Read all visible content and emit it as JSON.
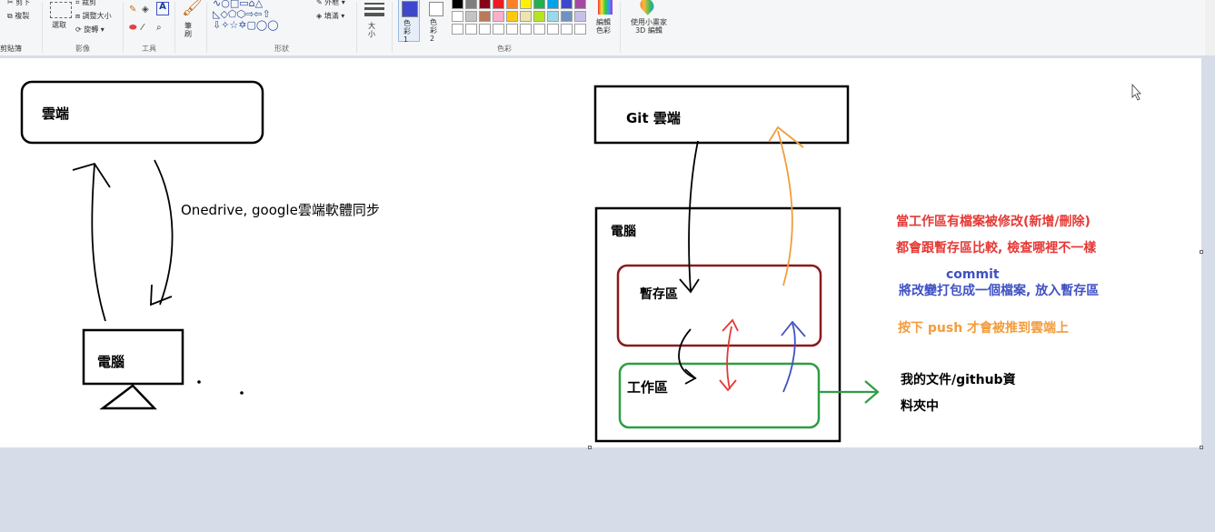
{
  "ribbon": {
    "clipboard": {
      "cut": "剪下",
      "copy": "複製",
      "label": "剪貼簿"
    },
    "image": {
      "select": "選取",
      "crop": "裁剪",
      "resize": "調整大小",
      "rotate": "旋轉",
      "label": "影像"
    },
    "tools": {
      "label": "工具"
    },
    "brushes": {
      "label": "筆刷"
    },
    "shapes": {
      "outline": "外框",
      "fill": "填滿",
      "label": "形狀"
    },
    "size": {
      "label": "大小"
    },
    "colors": {
      "color1": "色彩 1",
      "color2": "色彩 2",
      "edit": "編輯色彩",
      "label": "色彩"
    },
    "paint3d": {
      "label": "使用小畫家 3D 編輯"
    },
    "color1_value": "#3f48cc",
    "color2_value": "#ffffff",
    "palette_row1": [
      "#000000",
      "#7f7f7f",
      "#880015",
      "#ed1c24",
      "#ff7f27",
      "#fff200",
      "#22b14c",
      "#00a2e8",
      "#3f48cc",
      "#a349a4"
    ],
    "palette_row2": [
      "#ffffff",
      "#c3c3c3",
      "#b97a57",
      "#ffaec9",
      "#ffc90e",
      "#efe4b0",
      "#b5e61d",
      "#99d9ea",
      "#7092be",
      "#c8bfe7"
    ]
  },
  "drawing": {
    "cloud_label": "雲端",
    "sync_label": "Onedrive, google雲端軟體同步",
    "pc_label": "電腦",
    "git_cloud_label": "Git 雲端",
    "computer_label": "電腦",
    "staging_label": "暫存區",
    "workspace_label": "工作區",
    "red_note_1": "當工作區有檔案被修改(新增/刪除)",
    "red_note_2": "都會跟暫存區比較, 檢查哪裡不一樣",
    "commit_label": "commit",
    "blue_note": "將改變打包成一個檔案, 放入暫存區",
    "orange_note": "按下 push 才會被推到雲端上",
    "folder_note_1": "我的文件/github資",
    "folder_note_2": "料夾中"
  },
  "colors": {
    "red": "#e53935",
    "blue": "#3f51c4",
    "orange": "#f39c3c",
    "green": "#2e9e45",
    "darkred": "#8b1a1a"
  }
}
